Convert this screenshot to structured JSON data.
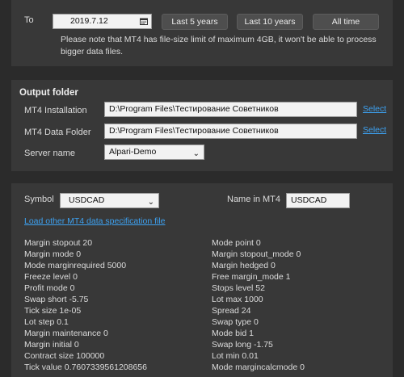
{
  "date_range": {
    "to_label": "To",
    "to_value": "2019.7.12",
    "buttons": [
      "Last 5 years",
      "Last 10 years",
      "All time"
    ],
    "note": "Please note that MT4 has file-size limit of maximum 4GB, it won't be able to process bigger data files."
  },
  "output_folder": {
    "title": "Output folder",
    "installation_label": "MT4 Installation",
    "installation_value": "D:\\Program Files\\Тестирование Советников",
    "data_folder_label": "MT4 Data Folder",
    "data_folder_value": "D:\\Program Files\\Тестирование Советников",
    "select_label": "Select",
    "server_label": "Server name",
    "server_value": "Alpari-Demo"
  },
  "symbol_panel": {
    "symbol_label": "Symbol",
    "symbol_value": "USDCAD",
    "name_label": "Name in MT4",
    "name_value": "USDCAD",
    "load_link": "Load other MT4 data specification file",
    "left_stats": [
      "Margin stopout 20",
      "Margin mode 0",
      "Mode marginrequired 5000",
      "Freeze level 0",
      "Profit mode 0",
      "Swap short -5.75",
      "Tick size 1e-05",
      "Lot step 0.1",
      "Margin maintenance 0",
      "Margin initial 0",
      "Contract size 100000",
      "Tick value 0.7607339561208656"
    ],
    "right_stats": [
      "Mode point 0",
      "Margin stopout_mode 0",
      "Margin hedged 0",
      "Free margin_mode 1",
      "Stops level 52",
      "Lot max 1000",
      "Spread 24",
      "Swap type 0",
      "Mode bid 1",
      "Swap long -1.75",
      "Lot min 0.01",
      "Mode margincalcmode 0"
    ]
  }
}
